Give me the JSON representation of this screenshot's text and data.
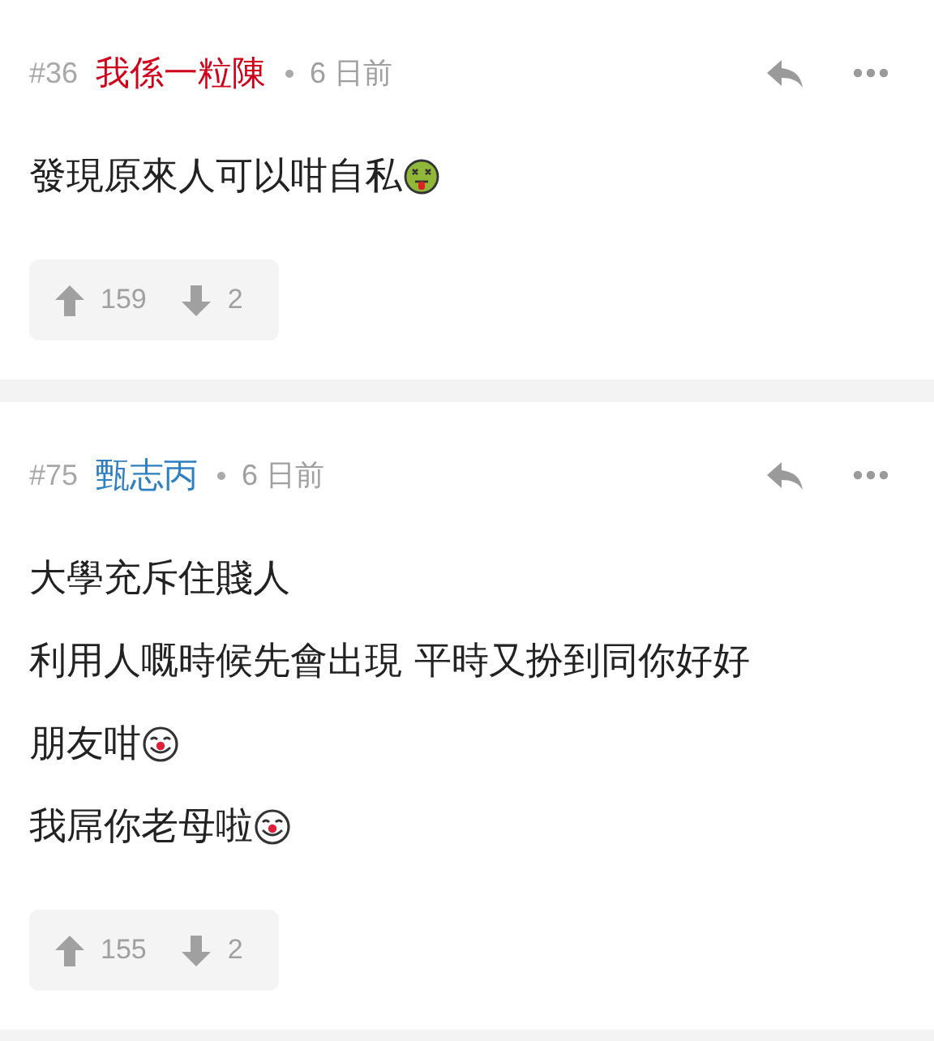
{
  "posts": [
    {
      "number": "#36",
      "author": "我係一粒陳",
      "color": "#d0021b",
      "time": "6 日前",
      "lines": [
        {
          "text": "發現原來人可以咁自私",
          "kind": "sick"
        }
      ],
      "upvotes": "159",
      "downvotes": "2"
    },
    {
      "number": "#75",
      "author": "甄志丙",
      "color": "#2f80c0",
      "time": "6 日前",
      "lines": [
        {
          "text": "大學充斥住賤人",
          "kind": "plain"
        },
        {
          "text": "利用人嘅時候先會出現 平時又扮到同你好好",
          "kind": "plain"
        },
        {
          "text": "朋友咁",
          "kind": "clown"
        },
        {
          "text": "我屌你老母啦",
          "kind": "clown"
        }
      ],
      "upvotes": "155",
      "downvotes": "2"
    }
  ]
}
